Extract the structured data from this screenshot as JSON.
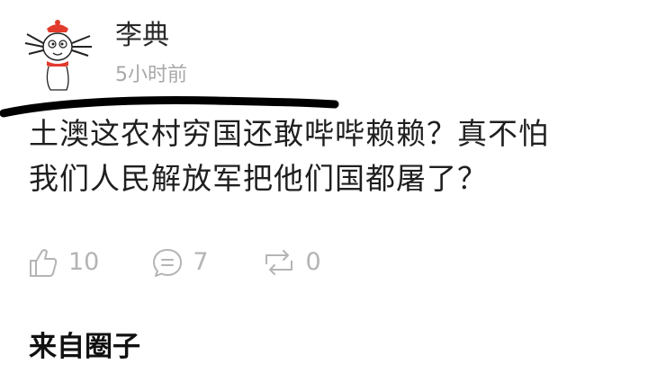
{
  "post": {
    "author": "李典",
    "time": "5小时前",
    "content_lines": [
      "土澳这农村穷国还敢哔哔赖赖？真不怕",
      "我们人民解放军把他们国都屠了？"
    ],
    "likes": "10",
    "comments": "7",
    "reposts": "0",
    "source": "来自圈子"
  },
  "icons": {
    "avatar": "cartoon-avatar",
    "like": "thumbs-up-icon",
    "comment": "comment-bubble-icon",
    "repost": "repost-arrows-icon"
  },
  "colors": {
    "text": "#1f1f1f",
    "muted": "#b4b4b4",
    "timestamp": "#a8a8a8",
    "scribble": "#000000",
    "scarf": "#e23b2e"
  }
}
